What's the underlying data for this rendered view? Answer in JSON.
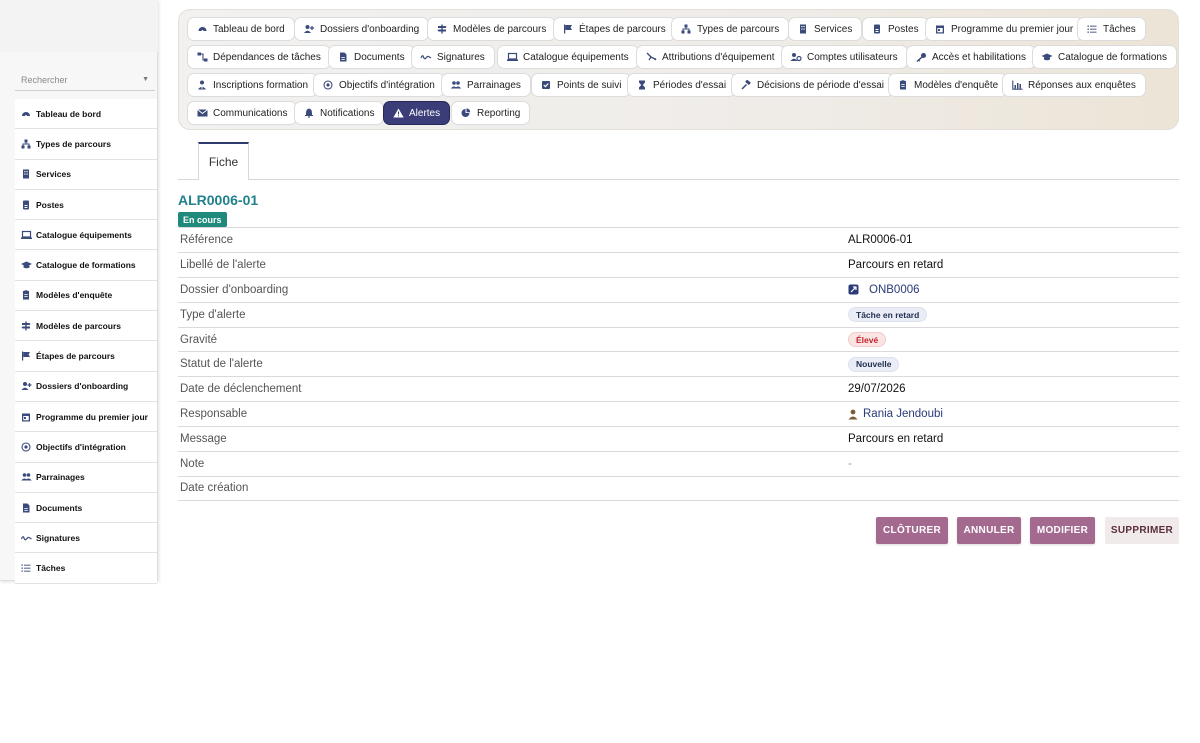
{
  "sidebar": {
    "search_placeholder": "Rechercher",
    "items": [
      {
        "label": "Tableau de bord",
        "icon": "dashboard-icon"
      },
      {
        "label": "Types de parcours",
        "icon": "sitemap-icon"
      },
      {
        "label": "Services",
        "icon": "building-icon"
      },
      {
        "label": "Postes",
        "icon": "badge-icon"
      },
      {
        "label": "Catalogue équipements",
        "icon": "laptop-icon"
      },
      {
        "label": "Catalogue de formations",
        "icon": "graduation-cap-icon"
      },
      {
        "label": "Modèles d'enquête",
        "icon": "clipboard-icon"
      },
      {
        "label": "Modèles de parcours",
        "icon": "signpost-icon"
      },
      {
        "label": "Étapes de parcours",
        "icon": "flag-icon"
      },
      {
        "label": "Dossiers d'onboarding",
        "icon": "user-plus-icon"
      },
      {
        "label": "Programme du premier jour",
        "icon": "calendar-icon"
      },
      {
        "label": "Objectifs d'intégration",
        "icon": "target-icon"
      },
      {
        "label": "Parrainages",
        "icon": "users-icon"
      },
      {
        "label": "Documents",
        "icon": "document-icon"
      },
      {
        "label": "Signatures",
        "icon": "signature-icon"
      },
      {
        "label": "Tâches",
        "icon": "task-list-icon"
      }
    ]
  },
  "modules": [
    {
      "label": "Tableau de bord",
      "icon": "dashboard-icon"
    },
    {
      "label": "Dossiers d'onboarding",
      "icon": "user-plus-icon"
    },
    {
      "label": "Modèles de parcours",
      "icon": "signpost-icon"
    },
    {
      "label": "Étapes de parcours",
      "icon": "flag-icon"
    },
    {
      "label": "Types de parcours",
      "icon": "sitemap-icon"
    },
    {
      "label": "Services",
      "icon": "building-icon"
    },
    {
      "label": "Postes",
      "icon": "badge-icon"
    },
    {
      "label": "Programme du premier jour",
      "icon": "calendar-icon"
    },
    {
      "label": "Tâches",
      "icon": "task-list-icon"
    },
    {
      "label": "Dépendances de tâches",
      "icon": "dependency-icon"
    },
    {
      "label": "Documents",
      "icon": "document-icon"
    },
    {
      "label": "Signatures",
      "icon": "signature-icon"
    },
    {
      "label": "Catalogue équipements",
      "icon": "laptop-icon"
    },
    {
      "label": "Attributions d'équipement",
      "icon": "hand-tool-icon"
    },
    {
      "label": "Comptes utilisateurs",
      "icon": "user-gear-icon"
    },
    {
      "label": "Accès et habilitations",
      "icon": "key-icon"
    },
    {
      "label": "Catalogue de formations",
      "icon": "graduation-cap-icon"
    },
    {
      "label": "Inscriptions formation",
      "icon": "user-tie-icon"
    },
    {
      "label": "Objectifs d'intégration",
      "icon": "target-icon"
    },
    {
      "label": "Parrainages",
      "icon": "users-icon"
    },
    {
      "label": "Points de suivi",
      "icon": "check-square-icon"
    },
    {
      "label": "Périodes d'essai",
      "icon": "hourglass-icon"
    },
    {
      "label": "Décisions de période d'essai",
      "icon": "gavel-icon"
    },
    {
      "label": "Modèles d'enquête",
      "icon": "clipboard-icon"
    },
    {
      "label": "Réponses aux enquêtes",
      "icon": "chart-icon"
    },
    {
      "label": "Communications",
      "icon": "envelope-icon"
    },
    {
      "label": "Notifications",
      "icon": "bell-icon"
    },
    {
      "label": "Alertes",
      "icon": "warning-icon",
      "active": true
    },
    {
      "label": "Reporting",
      "icon": "pie-chart-icon"
    }
  ],
  "tabs": {
    "fiche": "Fiche"
  },
  "record": {
    "title": "ALR0006-01",
    "status": "En cours",
    "fields": [
      {
        "label": "Référence",
        "value": "ALR0006-01"
      },
      {
        "label": "Libellé de l'alerte",
        "value": "Parcours en retard"
      },
      {
        "label": "Dossier d'onboarding",
        "value": "ONB0006"
      },
      {
        "label": "Type d'alerte",
        "value": "Tâche en retard"
      },
      {
        "label": "Gravité",
        "value": "Élevé"
      },
      {
        "label": "Statut de l'alerte",
        "value": "Nouvelle"
      },
      {
        "label": "Date de déclenchement",
        "value": "29/07/2026"
      },
      {
        "label": "Responsable",
        "value": "Rania Jendoubi"
      },
      {
        "label": "Message",
        "value": "Parcours en retard"
      },
      {
        "label": "Note",
        "value": "-"
      },
      {
        "label": "Date création",
        "value": ""
      }
    ]
  },
  "actions": {
    "close": "CLÔTURER",
    "cancel": "ANNULER",
    "edit": "MODIFIER",
    "delete": "SUPPRIMER"
  },
  "colors": {
    "accent_title": "#21818c",
    "status_badge": "#1f8a7b",
    "active_chip": "#3a3d78",
    "action_button": "#a3698f"
  }
}
